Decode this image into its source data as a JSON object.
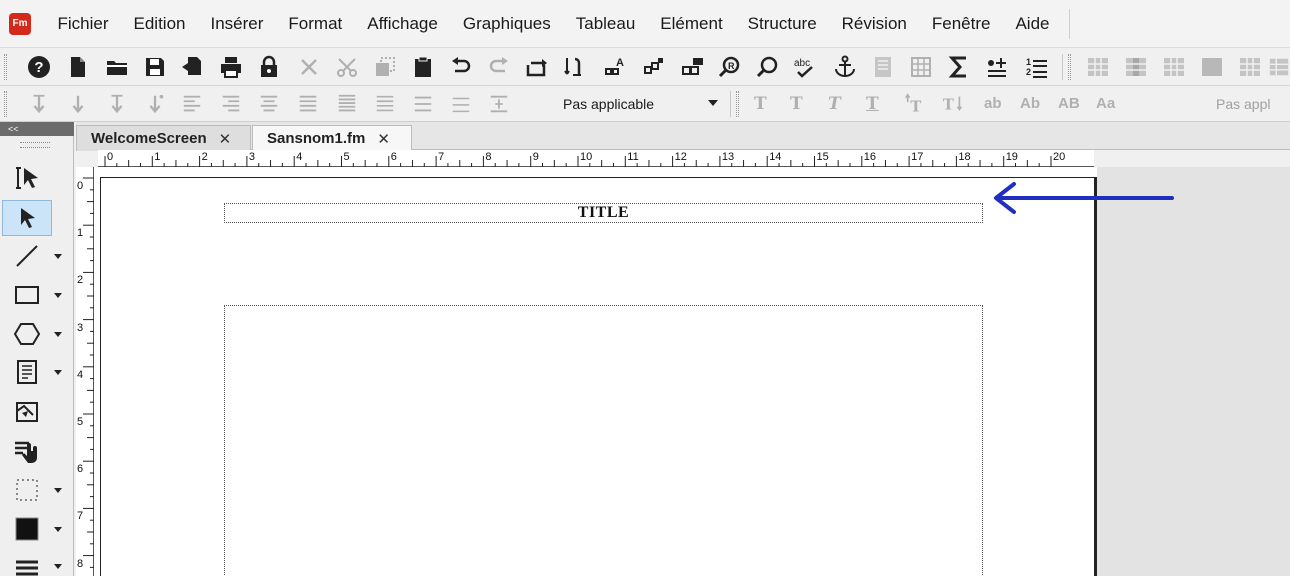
{
  "app": {
    "icon_label": "Fm",
    "brand_color": "#d42a1c"
  },
  "menu": {
    "items": [
      "Fichier",
      "Edition",
      "Insérer",
      "Format",
      "Affichage",
      "Graphiques",
      "Tableau",
      "Elément",
      "Structure",
      "Révision",
      "Fenêtre",
      "Aide"
    ]
  },
  "toolbar1": {
    "buttons": [
      "help-icon",
      "new-document-icon",
      "open-folder-icon",
      "save-icon",
      "save-as-icon",
      "print-icon",
      "lock-icon",
      "delete-icon",
      "cut-icon",
      "copy-icon",
      "paste-icon",
      "undo-icon",
      "redo-icon",
      "repeat-icon",
      "spell-paragraph-icon",
      "font-up-icon",
      "insert-table-icon",
      "grid-icon",
      "find-icon",
      "search-icon",
      "spell-check-icon",
      "anchor-icon",
      "document-icon",
      "table-icon",
      "sum-icon",
      "insert-equation-icon",
      "numbered-list-icon",
      "table-rows-icon",
      "table-cols-icon",
      "table-cell-icon",
      "table-shade-icon",
      "table-grid-icon",
      "table-more-icon"
    ]
  },
  "toolbar2": {
    "paragraph_tag": "Pas applicable",
    "char_tag_truncated": "Pas appl",
    "text_buttons": [
      "T",
      "T",
      "T",
      "T",
      "ab",
      "Ab",
      "AB",
      "Aa"
    ]
  },
  "tabs": [
    {
      "label": "WelcomeScreen",
      "close": "✕"
    },
    {
      "label": "Sansnom1.fm",
      "close": "✕"
    }
  ],
  "tools": {
    "collapse_label": "<<"
  },
  "ruler": {
    "h_labels": [
      "0",
      "1",
      "2",
      "3",
      "4",
      "5",
      "6",
      "7",
      "8",
      "9",
      "10",
      "11",
      "12",
      "13",
      "14",
      "15",
      "16",
      "17",
      "18",
      "19",
      "20"
    ],
    "v_labels": [
      "0",
      "1",
      "2",
      "3",
      "4",
      "5",
      "6",
      "7",
      "8"
    ]
  },
  "document": {
    "title_text": "TITLE"
  },
  "annotation": {
    "arrow_color": "#1f2fbf"
  }
}
